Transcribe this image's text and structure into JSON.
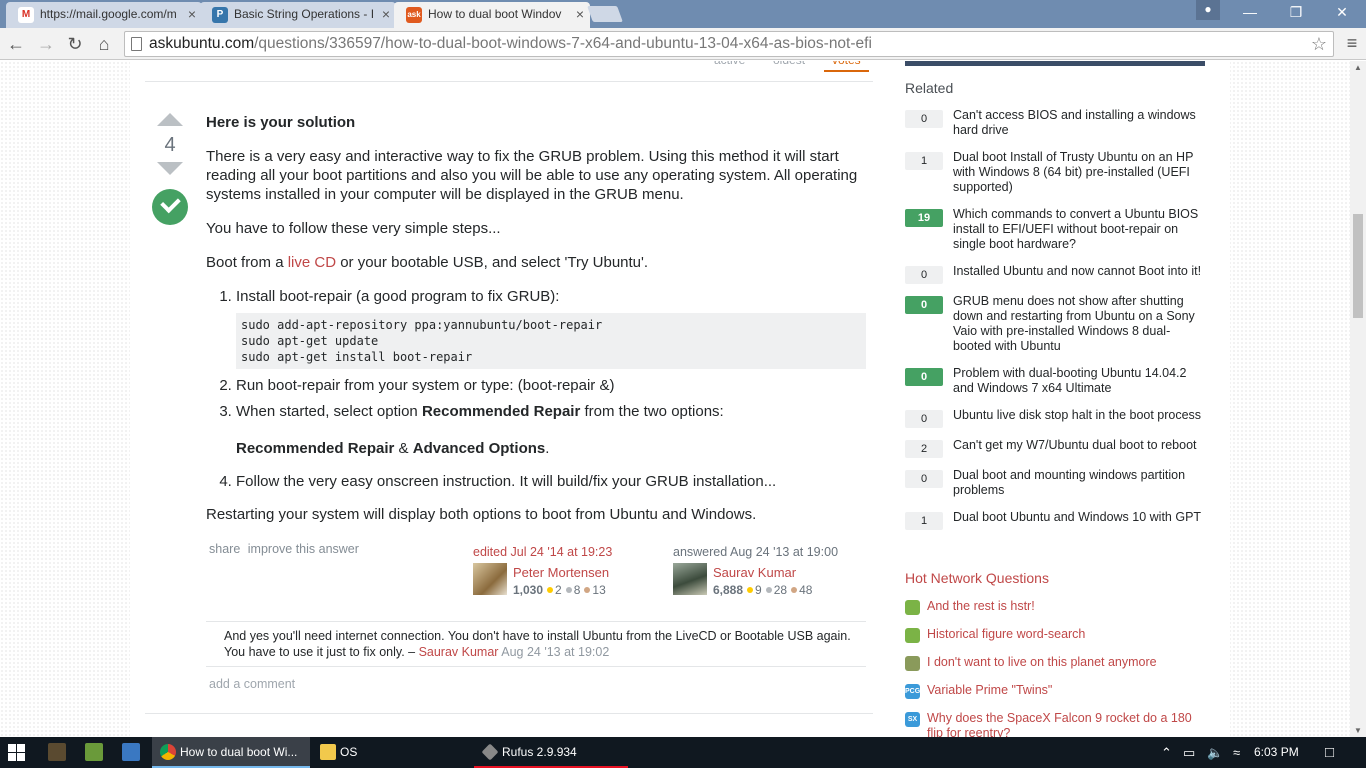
{
  "browser": {
    "tabs": [
      {
        "title": "https://mail.google.com/m",
        "icon": "gmail-icon"
      },
      {
        "title": "Basic String Operations - I",
        "icon": "python-icon"
      },
      {
        "title": "How to dual boot Windov",
        "icon": "askubuntu-icon"
      }
    ],
    "address": {
      "host": "askubuntu.com",
      "path": "/questions/336597/how-to-dual-boot-windows-7-x64-and-ubuntu-13-04-x64-as-bios-not-efi"
    }
  },
  "sort_tabs": [
    "active",
    "oldest",
    "votes"
  ],
  "answer": {
    "vote_count": "4",
    "heading": "Here is your solution",
    "intro": "There is a very easy and interactive way to fix the GRUB problem. Using this method it will start reading all your boot partitions and also you will be able to use any operating system. All operating systems installed in your computer will be displayed in the GRUB menu.",
    "follow": "You have to follow these very simple steps...",
    "boot_pre": "Boot from a ",
    "boot_link": "live CD",
    "boot_post": " or your bootable USB, and select 'Try Ubuntu'.",
    "step1": "Install boot-repair (a good program to fix GRUB):",
    "code": "sudo add-apt-repository ppa:yannubuntu/boot-repair\nsudo apt-get update\nsudo apt-get install boot-repair",
    "step2": "Run boot-repair from your system or type: (boot-repair &)",
    "step3_pre": "When started, select option ",
    "step3_bold": "Recommended Repair",
    "step3_post": " from the two options:",
    "options_a": "Recommended Repair",
    "options_sep": " & ",
    "options_b": "Advanced Options",
    "options_end": ".",
    "step4": "Follow the very easy onscreen instruction. It will build/fix your GRUB installation...",
    "closing": "Restarting your system will display both options to boot from Ubuntu and Windows.",
    "share": "share",
    "improve": "improve this answer",
    "edited": {
      "action": "edited Jul 24 '14 at 19:23",
      "user": "Peter Mortensen",
      "rep": "1,030",
      "gold": "2",
      "silver": "8",
      "bronze": "13"
    },
    "answered": {
      "action": "answered Aug 24 '13 at 19:00",
      "user": "Saurav Kumar",
      "rep": "6,888",
      "gold": "9",
      "silver": "28",
      "bronze": "48"
    },
    "comment": {
      "text": "And yes you'll need internet connection. You don't have to install Ubuntu from the LiveCD or Bootable USB again. You have to use it just to fix only. – ",
      "user": "Saurav Kumar",
      "date": " Aug 24 '13 at 19:02"
    },
    "add_comment": "add a comment"
  },
  "sidebar": {
    "related_title": "Related",
    "related": [
      {
        "score": "0",
        "accepted": false,
        "title": "Can't access BIOS and installing a windows hard drive"
      },
      {
        "score": "1",
        "accepted": false,
        "title": "Dual boot Install of Trusty Ubuntu on an HP with Windows 8 (64 bit) pre-installed (UEFI supported)"
      },
      {
        "score": "19",
        "accepted": true,
        "title": "Which commands to convert a Ubuntu BIOS install to EFI/UEFI without boot-repair on single boot hardware?"
      },
      {
        "score": "0",
        "accepted": false,
        "title": "Installed Ubuntu and now cannot Boot into it!"
      },
      {
        "score": "0",
        "accepted": true,
        "title": "GRUB menu does not show after shutting down and restarting from Ubuntu on a Sony Vaio with pre-installed Windows 8 dual-booted with Ubuntu"
      },
      {
        "score": "0",
        "accepted": true,
        "title": "Problem with dual-booting Ubuntu 14.04.2 and Windows 7 x64 Ultimate"
      },
      {
        "score": "0",
        "accepted": false,
        "title": "Ubuntu live disk stop halt in the boot process"
      },
      {
        "score": "2",
        "accepted": false,
        "title": "Can't get my W7/Ubuntu dual boot to reboot"
      },
      {
        "score": "0",
        "accepted": false,
        "title": "Dual boot and mounting windows partition problems"
      },
      {
        "score": "1",
        "accepted": false,
        "title": "Dual boot Ubuntu and Windows 10 with GPT"
      }
    ],
    "hot_title": "Hot Network Questions",
    "hot": [
      {
        "title": "And the rest is hstr!",
        "site_label": "",
        "site_color": "#7bb346"
      },
      {
        "title": "Historical figure word-search",
        "site_label": "",
        "site_color": "#7bb346"
      },
      {
        "title": "I don't want to live on this planet anymore",
        "site_label": "",
        "site_color": "#8a9a5b"
      },
      {
        "title": "Variable Prime \"Twins\"",
        "site_label": "PCG",
        "site_color": "#3b9ad9"
      },
      {
        "title": "Why does the SpaceX Falcon 9 rocket do a 180 flip for reentry?",
        "site_label": "SX",
        "site_color": "#3b9ad9"
      }
    ]
  },
  "taskbar": {
    "tasks": [
      {
        "label": "How to dual boot Wi...",
        "active": true
      },
      {
        "label": "OS",
        "active": false
      },
      {
        "label": "Rufus 2.9.934",
        "active": false
      }
    ],
    "clock": "6:03 PM"
  },
  "colors": {
    "accent": "#c04848",
    "accepted_green": "#45a163",
    "taskbar": "#101820"
  }
}
